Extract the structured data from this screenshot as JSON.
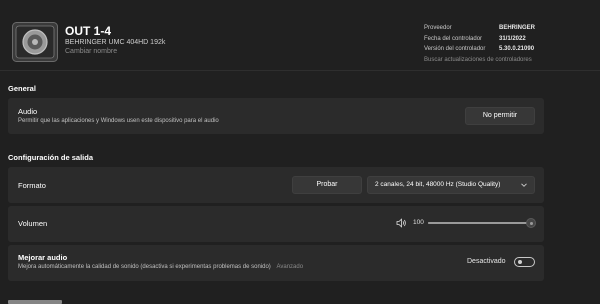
{
  "device": {
    "title": "OUT 1-4",
    "subtitle": "BEHRINGER UMC 404HD 192k",
    "rename_label": "Cambiar nombre",
    "icon": "speaker-icon"
  },
  "info": {
    "provider_label": "Proveedor",
    "provider_value": "BEHRINGER",
    "driver_date_label": "Fecha del controlador",
    "driver_date_value": "31/1/2022",
    "driver_version_label": "Versión del controlador",
    "driver_version_value": "5.30.0.21090",
    "update_link": "Buscar actualizaciones de controladores"
  },
  "general": {
    "section_title": "General",
    "audio_title": "Audio",
    "audio_desc": "Permitir que las aplicaciones y Windows usen este dispositivo para el audio",
    "disallow_button": "No permitir"
  },
  "output": {
    "section_title": "Configuración de salida",
    "format_label": "Formato",
    "test_button": "Probar",
    "format_value": "2 canales, 24 bit, 48000 Hz (Studio Quality)",
    "volume_label": "Volumen",
    "volume_value": "100",
    "volume_level": 1.0,
    "enhance_title": "Mejorar audio",
    "enhance_desc": "Mejora automáticamente la calidad de sonido (desactiva si experimentas problemas de sonido)",
    "enhance_advanced": "Avanzado",
    "enhance_state": "Desactivado",
    "enhance_on": false
  },
  "colors": {
    "background": "#202020",
    "card": "#2b2b2b",
    "button": "#373737"
  }
}
